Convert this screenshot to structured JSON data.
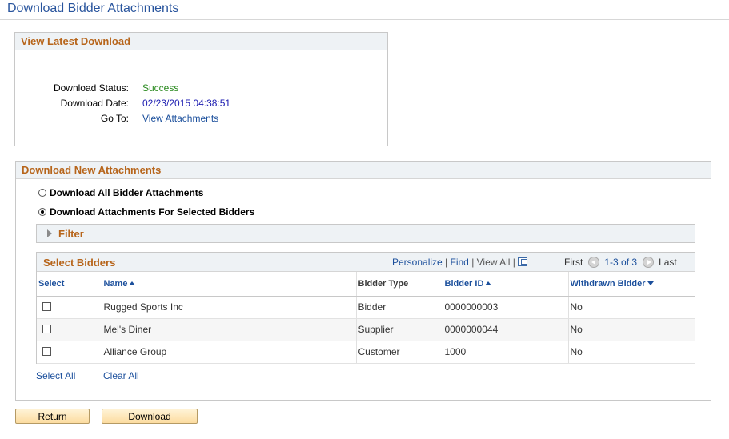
{
  "page": {
    "title": "Download Bidder Attachments"
  },
  "latest_download": {
    "header": "View Latest Download",
    "status_label": "Download Status:",
    "status_value": "Success",
    "date_label": "Download Date:",
    "date_value": "02/23/2015 04:38:51",
    "goto_label": "Go To:",
    "goto_link": "View Attachments"
  },
  "new_attachments": {
    "header": "Download New Attachments",
    "option_all": "Download All Bidder Attachments",
    "option_selected": "Download Attachments For Selected Bidders",
    "selected_option": "option_selected",
    "filter_label": "Filter"
  },
  "grid": {
    "title": "Select Bidders",
    "personalize": "Personalize",
    "find": "Find",
    "view_all": "View All",
    "first": "First",
    "range": "1-3 of 3",
    "last": "Last",
    "columns": {
      "select": "Select",
      "name": "Name",
      "bidder_type": "Bidder Type",
      "bidder_id": "Bidder ID",
      "withdrawn": "Withdrawn Bidder"
    },
    "rows": [
      {
        "name": "Rugged Sports Inc",
        "bidder_type": "Bidder",
        "bidder_id": "0000000003",
        "withdrawn": "No"
      },
      {
        "name": "Mel's Diner",
        "bidder_type": "Supplier",
        "bidder_id": "0000000044",
        "withdrawn": "No"
      },
      {
        "name": "Alliance Group",
        "bidder_type": "Customer",
        "bidder_id": "1000",
        "withdrawn": "No"
      }
    ],
    "select_all": "Select All",
    "clear_all": "Clear All"
  },
  "buttons": {
    "return": "Return",
    "download": "Download"
  },
  "colors": {
    "title": "#28549d",
    "section_header": "#b7651b",
    "link": "#1b4f9c",
    "success": "#2a8a1f",
    "button_bg": "#fcdca0"
  }
}
